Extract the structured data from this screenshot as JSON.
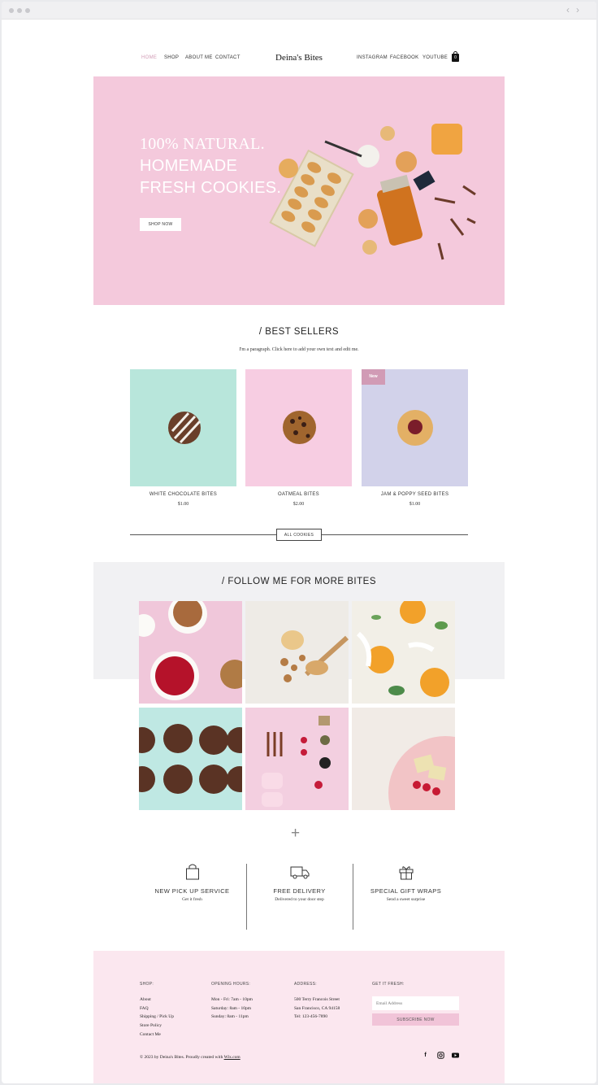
{
  "nav": {
    "left": [
      "HOME",
      "SHOP",
      "ABOUT ME",
      "CONTACT"
    ],
    "brand": "Deina's Bites",
    "right": [
      "INSTAGRAM",
      "FACEBOOK",
      "YOUTUBE"
    ],
    "cart_count": "0"
  },
  "hero": {
    "line1": "100% NATURAL.",
    "line2": "HOMEMADE",
    "line3": "FRESH COOKIES.",
    "button": "SHOP NOW"
  },
  "best": {
    "title": "/ BEST SELLERS",
    "paragraph": "I'm a paragraph. Click here to add your own text and edit me.",
    "products": [
      {
        "name": "WHITE CHOCOLATE BITES",
        "price": "$1.00",
        "bg": "#b8e6db"
      },
      {
        "name": "OATMEAL BITES",
        "price": "$2.00",
        "bg": "#f7cde2"
      },
      {
        "name": "JAM & POPPY SEED BITES",
        "price": "$1.00",
        "bg": "#d2d2ea",
        "badge": "New"
      }
    ],
    "all_button": "ALL COOKIES"
  },
  "follow": {
    "title": "/ FOLLOW ME FOR MORE BITES"
  },
  "features": [
    {
      "title": "NEW PICK UP SERVICE",
      "sub": "Get it fresh",
      "icon": "shopping-bag-icon"
    },
    {
      "title": "FREE DELIVERY",
      "sub": "Delivered to your door step",
      "icon": "truck-icon"
    },
    {
      "title": "SPECIAL GIFT WRAPS",
      "sub": "Send a sweet surprise",
      "icon": "gift-icon"
    }
  ],
  "footer": {
    "shop_h": "SHOP:",
    "shop_links": [
      "About",
      "FAQ",
      "Shipping / Pick Up",
      "Store Policy",
      "Contact Me"
    ],
    "hours_h": "OPENING HOURS:",
    "hours": [
      "Mon - Fri: 7am - 10pm",
      "Saturday: 8am - 10pm",
      "Sunday: 8am - 11pm"
    ],
    "addr_h": "ADDRESS:",
    "addr": [
      "500 Terry Francois Street",
      "San Francisco, CA 94158",
      "Tel: 123-456-7890"
    ],
    "fresh_h": "GET IT FRESH:",
    "email_placeholder": "Email Address",
    "subscribe": "SUBSCRIBE NOW",
    "copyright": "© 2023 by Deina's Bites. Proudly created with ",
    "wix": "Wix.com"
  },
  "colors": {
    "accent_pink": "#f4c9dc",
    "link_active": "#d19bb5"
  }
}
